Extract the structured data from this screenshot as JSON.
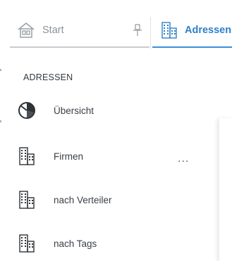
{
  "tabs": [
    {
      "label": "Start",
      "icon": "home-icon",
      "pinned": true
    },
    {
      "label": "Adressen",
      "icon": "building-icon",
      "active": true
    }
  ],
  "sidebar": {
    "section_title": "ADRESSEN",
    "items": [
      {
        "label": "Übersicht",
        "icon": "pie-chart-icon"
      },
      {
        "label": "Firmen",
        "icon": "building-icon",
        "more": "..."
      },
      {
        "label": "nach Verteiler",
        "icon": "building-icon"
      },
      {
        "label": "nach Tags",
        "icon": "building-icon"
      }
    ]
  },
  "colors": {
    "accent": "#2f80c8",
    "text": "#3b4046",
    "muted": "#8c9299"
  }
}
